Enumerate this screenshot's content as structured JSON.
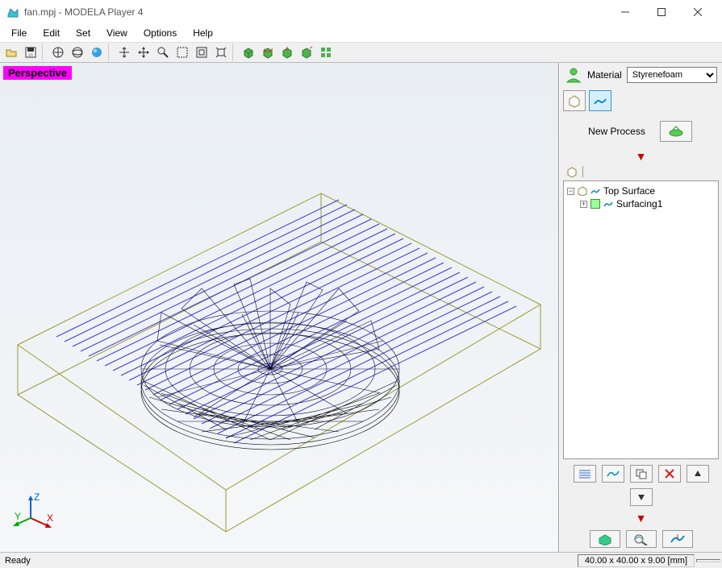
{
  "window": {
    "title": "fan.mpj - MODELA Player 4"
  },
  "menu": {
    "items": [
      "File",
      "Edit",
      "Set",
      "View",
      "Options",
      "Help"
    ]
  },
  "viewport": {
    "label": "Perspective"
  },
  "side": {
    "material_label": "Material",
    "material_value": "Styrenefoam",
    "new_process": "New Process"
  },
  "tree": {
    "root": "Top Surface",
    "child": "Surfacing1"
  },
  "status": {
    "ready": "Ready",
    "dims": "40.00 x 40.00 x 9.00 [mm]"
  }
}
